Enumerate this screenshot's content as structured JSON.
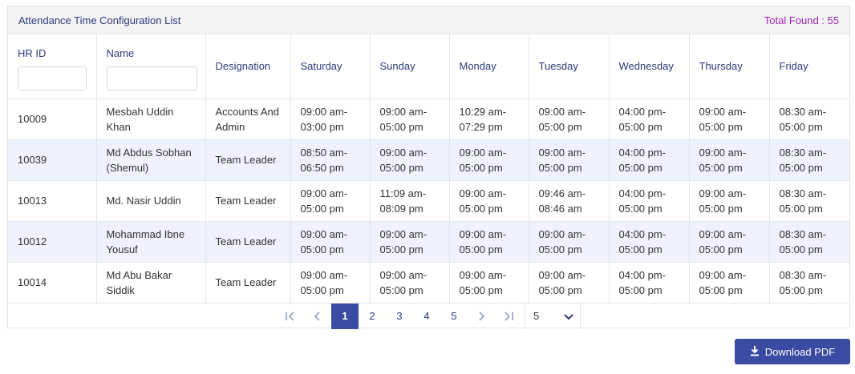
{
  "panel": {
    "title": "Attendance Time Configuration List",
    "total_found": "Total Found : 55"
  },
  "table": {
    "headers": [
      "HR ID",
      "Name",
      "Designation",
      "Saturday",
      "Sunday",
      "Monday",
      "Tuesday",
      "Wednesday",
      "Thursday",
      "Friday"
    ],
    "filters": {
      "hr_id": "",
      "name": ""
    },
    "rows": [
      [
        "10009",
        "Mesbah Uddin Khan",
        "Accounts And Admin",
        "09:00 am-03:00 pm",
        "09:00 am-05:00 pm",
        "10:29 am-07:29 pm",
        "09:00 am-05:00 pm",
        "04:00 pm-05:00 pm",
        "09:00 am-05:00 pm",
        "08:30 am-05:00 pm"
      ],
      [
        "10039",
        "Md Abdus Sobhan (Shemul)",
        "Team Leader",
        "08:50 am-06:50 pm",
        "09:00 am-05:00 pm",
        "09:00 am-05:00 pm",
        "09:00 am-05:00 pm",
        "04:00 pm-05:00 pm",
        "09:00 am-05:00 pm",
        "08:30 am-05:00 pm"
      ],
      [
        "10013",
        "Md. Nasir Uddin",
        "Team Leader",
        "09:00 am-05:00 pm",
        "11:09 am-08:09 pm",
        "09:00 am-05:00 pm",
        "09:46 am-08:46 am",
        "04:00 pm-05:00 pm",
        "09:00 am-05:00 pm",
        "08:30 am-05:00 pm"
      ],
      [
        "10012",
        "Mohammad Ibne Yousuf",
        "Team Leader",
        "09:00 am-05:00 pm",
        "09:00 am-05:00 pm",
        "09:00 am-05:00 pm",
        "09:00 am-05:00 pm",
        "04:00 pm-05:00 pm",
        "09:00 am-05:00 pm",
        "08:30 am-05:00 pm"
      ],
      [
        "10014",
        "Md Abu Bakar Siddik",
        "Team Leader",
        "09:00 am-05:00 pm",
        "09:00 am-05:00 pm",
        "09:00 am-05:00 pm",
        "09:00 am-05:00 pm",
        "04:00 pm-05:00 pm",
        "09:00 am-05:00 pm",
        "08:30 am-05:00 pm"
      ]
    ]
  },
  "pagination": {
    "pages": [
      "1",
      "2",
      "3",
      "4",
      "5"
    ],
    "current_page": "1",
    "page_size": "5",
    "icons": {
      "first": "first-page-icon",
      "prev": "prev-page-icon",
      "next": "next-page-icon",
      "last": "last-page-icon",
      "dropdown": "chevron-down-icon"
    }
  },
  "actions": {
    "download_label": "Download PDF",
    "download_icon": "download-icon"
  },
  "colors": {
    "accent": "#3b4aa3",
    "header_text": "#2d3a7a",
    "total_found": "#9c27b0",
    "row_alt": "#eef2fd"
  }
}
